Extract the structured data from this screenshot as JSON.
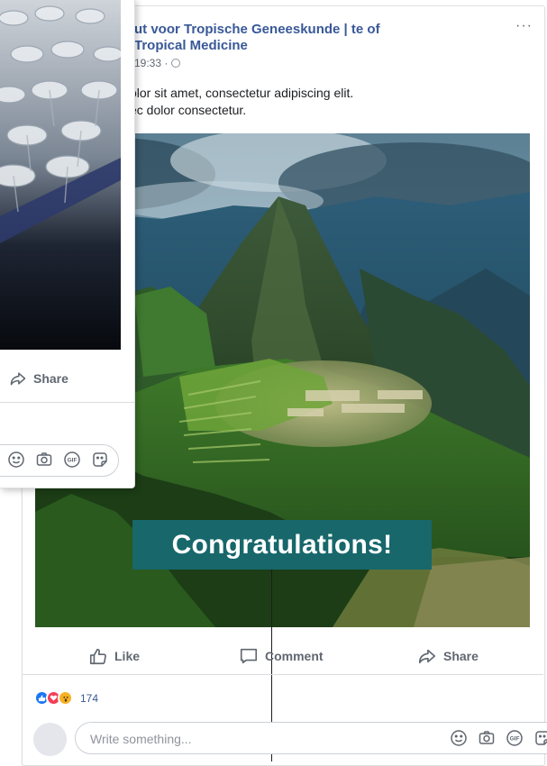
{
  "post": {
    "page_name": "ut voor Tropische Geneeskunde | te of Tropical Medicine",
    "time": "19:33 ·",
    "more_label": "···",
    "text_line1": "olor sit amet, consectetur adipiscing elit.",
    "text_line2": "ec dolor consectetur.",
    "overlay_text": "Congratulations!"
  },
  "actions": {
    "like": "Like",
    "comment": "Comment",
    "share": "Share"
  },
  "reactions": {
    "count": "174",
    "types": [
      "like",
      "love",
      "wow"
    ]
  },
  "comment": {
    "placeholder": "Write something..."
  },
  "front_card": {
    "share": "Share"
  },
  "colors": {
    "link_blue": "#385898",
    "banner_teal": "#17676b",
    "action_gray": "#606770"
  }
}
